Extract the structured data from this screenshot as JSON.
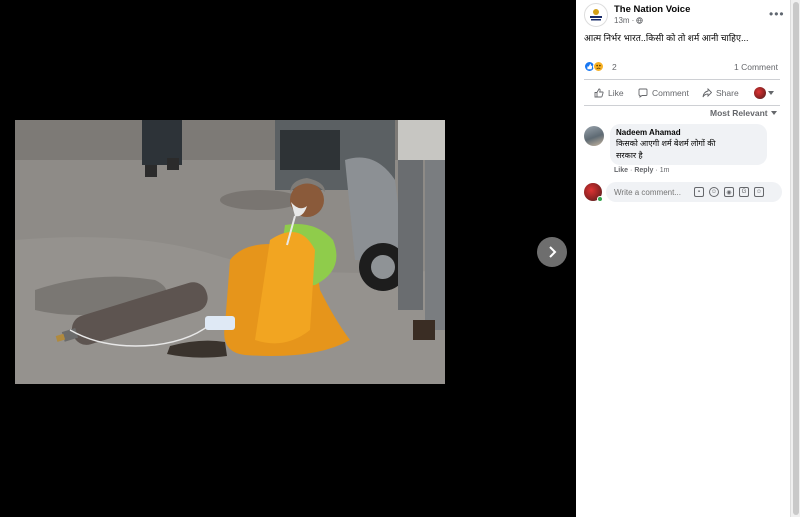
{
  "post": {
    "page_name": "The Nation Voice",
    "time": "13m",
    "privacy_icon": "globe-icon",
    "caption": "आत्म निर्भर भारत..किसी को तो शर्म आनी चाहिए...",
    "reaction_count": "2",
    "reaction_icons": [
      "like-icon",
      "sad-icon"
    ],
    "comment_count": "1 Comment"
  },
  "actions": {
    "like": "Like",
    "comment": "Comment",
    "share": "Share"
  },
  "sort_label": "Most Relevant",
  "comments": [
    {
      "author": "Nadeem Ahamad",
      "text_line1": "किसको आएगी शर्म बेशर्म लोगों की",
      "text_line2": "सरकार है",
      "like": "Like",
      "reply": "Reply",
      "time": "1m"
    }
  ],
  "composer": {
    "placeholder": "Write a comment..."
  },
  "colors": {
    "accent": "#1877f2",
    "online": "#31a24c",
    "sad": "#f7b125"
  }
}
